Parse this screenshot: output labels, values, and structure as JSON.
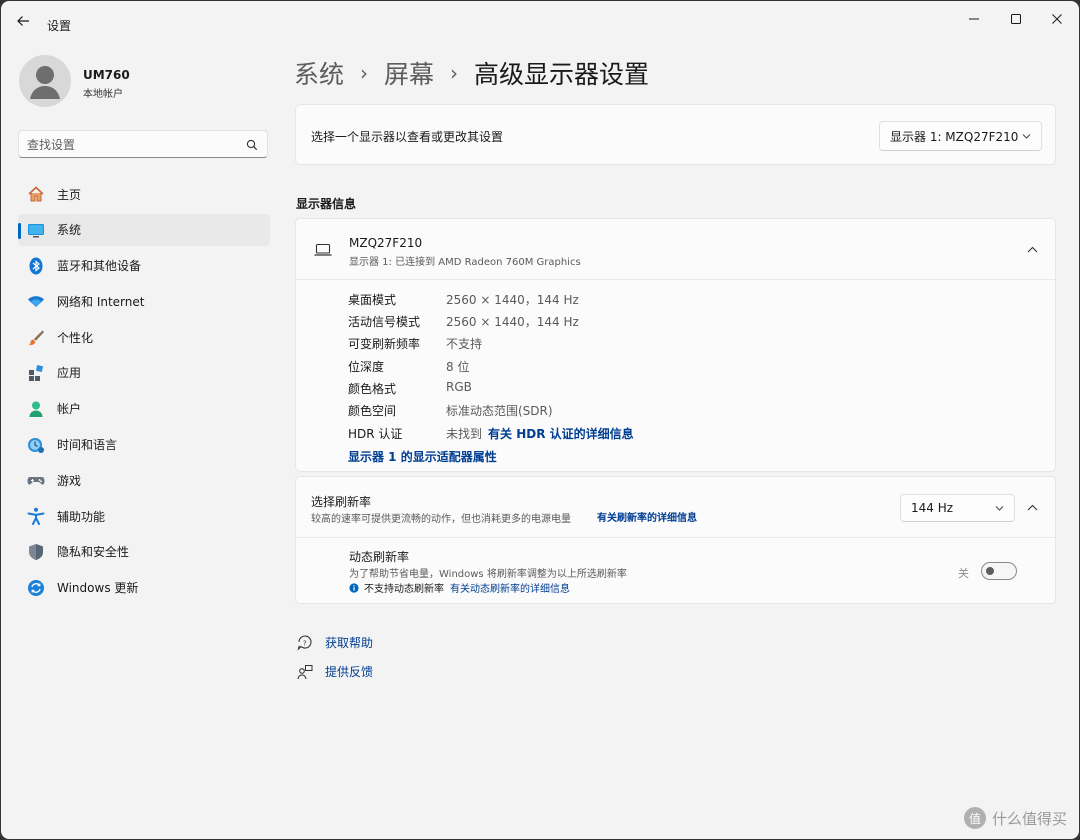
{
  "window": {
    "title": "设置"
  },
  "user": {
    "name": "UM760",
    "account_type": "本地帐户"
  },
  "search": {
    "placeholder": "查找设置"
  },
  "sidebar": {
    "items": [
      {
        "label": "主页",
        "icon": "home-icon"
      },
      {
        "label": "系统",
        "icon": "system-icon",
        "active": true
      },
      {
        "label": "蓝牙和其他设备",
        "icon": "bluetooth-icon"
      },
      {
        "label": "网络和 Internet",
        "icon": "wifi-icon"
      },
      {
        "label": "个性化",
        "icon": "brush-icon"
      },
      {
        "label": "应用",
        "icon": "apps-icon"
      },
      {
        "label": "帐户",
        "icon": "account-icon"
      },
      {
        "label": "时间和语言",
        "icon": "time-language-icon"
      },
      {
        "label": "游戏",
        "icon": "gamepad-icon"
      },
      {
        "label": "辅助功能",
        "icon": "accessibility-icon"
      },
      {
        "label": "隐私和安全性",
        "icon": "shield-icon"
      },
      {
        "label": "Windows 更新",
        "icon": "update-icon"
      }
    ]
  },
  "breadcrumb": {
    "level1": "系统",
    "level2": "屏幕",
    "current": "高级显示器设置"
  },
  "display_select": {
    "label": "选择一个显示器以查看或更改其设置",
    "value": "显示器 1: MZQ27F210"
  },
  "display_info": {
    "section_title": "显示器信息",
    "monitor_name": "MZQ27F210",
    "monitor_sub": "显示器 1: 已连接到 AMD Radeon 760M Graphics",
    "rows": [
      {
        "key": "桌面模式",
        "value": "2560 × 1440，144 Hz"
      },
      {
        "key": "活动信号模式",
        "value": "2560 × 1440，144 Hz"
      },
      {
        "key": "可变刷新频率",
        "value": "不支持"
      },
      {
        "key": "位深度",
        "value": "8 位"
      },
      {
        "key": "颜色格式",
        "value": "RGB"
      },
      {
        "key": "颜色空间",
        "value": "标准动态范围(SDR)"
      }
    ],
    "hdr_key": "HDR 认证",
    "hdr_value": "未找到",
    "hdr_link": "有关 HDR 认证的详细信息",
    "adapter_link": "显示器 1 的显示适配器属性"
  },
  "refresh": {
    "title": "选择刷新率",
    "desc": "较高的速率可提供更流畅的动作，但也消耗更多的电源电量",
    "link": "有关刷新率的详细信息",
    "value": "144 Hz"
  },
  "dynamic_refresh": {
    "title": "动态刷新率",
    "desc": "为了帮助节省电量，Windows 将刷新率调整为以上所选刷新率",
    "note": "不支持动态刷新率",
    "note_link": "有关动态刷新率的详细信息",
    "toggle_label": "关",
    "enabled": false
  },
  "help": {
    "get_help": "获取帮助",
    "feedback": "提供反馈"
  },
  "watermark": {
    "badge": "值",
    "text": "什么值得买"
  },
  "colors": {
    "accent": "#0067c0",
    "link": "#003e92",
    "background": "#f3f3f3",
    "card": "#fbfbfb"
  }
}
